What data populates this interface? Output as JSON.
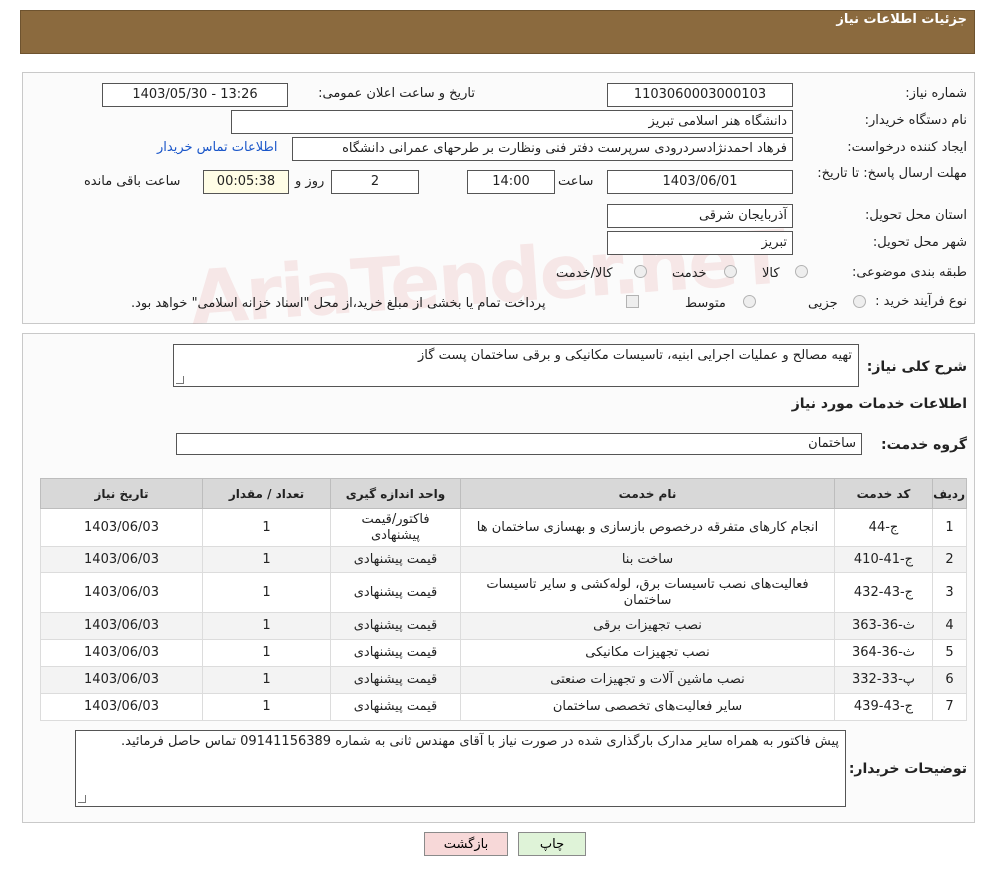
{
  "header": {
    "title": "جزئیات اطلاعات نیاز"
  },
  "watermark": "AriaTender.neT",
  "form": {
    "need_number_label": "شماره نیاز:",
    "need_number": "1103060003000103",
    "announce_label": "تاریخ و ساعت اعلان عمومی:",
    "announce_value": "1403/05/30 - 13:26",
    "buyer_org_label": "نام دستگاه خریدار:",
    "buyer_org": "دانشگاه هنر اسلامی تبریز",
    "requester_label": "ایجاد کننده درخواست:",
    "requester": "فرهاد احمدنژادسردرودی سرپرست دفتر فنی ونظارت بر طرحهای عمرانی دانشگاه",
    "contact_link": "اطلاعات تماس خریدار",
    "deadline_label": "مهلت ارسال پاسخ: تا تاریخ:",
    "deadline_date": "1403/06/01",
    "time_label": "ساعت",
    "deadline_time": "14:00",
    "days_value": "2",
    "days_label": "روز و",
    "remaining_value": "00:05:38",
    "remaining_label": "ساعت باقی مانده",
    "province_label": "استان محل تحویل:",
    "province": "آذربایجان شرقی",
    "city_label": "شهر محل تحویل:",
    "city": "تبریز",
    "category_label": "طبقه بندی موضوعی:",
    "category_options": [
      "کالا",
      "خدمت",
      "کالا/خدمت"
    ],
    "process_label": "نوع فرآیند خرید :",
    "process_options": [
      "جزیی",
      "متوسط"
    ],
    "payment_note": "پرداخت تمام یا بخشی از مبلغ خرید،از محل \"اسناد خزانه اسلامی\" خواهد بود."
  },
  "details": {
    "summary_label": "شرح کلی نیاز:",
    "summary": "تهیه مصالح و عملیات اجرایی ابنیه، تاسیسات مکانیکی و برقی ساختمان پست گاز",
    "services_title": "اطلاعات خدمات مورد نیاز",
    "service_group_label": "گروه خدمت:",
    "service_group": "ساختمان",
    "buyer_notes_label": "توضیحات خریدار:",
    "buyer_notes": "پیش فاکتور به همراه سایر مدارک بارگذاری شده در صورت نیاز با آقای مهندس ثانی به شماره 09141156389 تماس حاصل فرمائید."
  },
  "table": {
    "headers": [
      "ردیف",
      "کد خدمت",
      "نام خدمت",
      "واحد اندازه گیری",
      "تعداد / مقدار",
      "تاریخ نیاز"
    ],
    "rows": [
      {
        "row": "1",
        "code": "ج-44",
        "name": "انجام کارهای متفرقه درخصوص بازسازی و بهسازی ساختمان ها",
        "unit": "فاکتور/قیمت پیشنهادی",
        "qty": "1",
        "date": "1403/06/03"
      },
      {
        "row": "2",
        "code": "ج-41-410",
        "name": "ساخت بنا",
        "unit": "قیمت پیشنهادی",
        "qty": "1",
        "date": "1403/06/03"
      },
      {
        "row": "3",
        "code": "ج-43-432",
        "name": "فعالیت‌های نصب تاسیسات برق، لوله‌کشی و سایر تاسیسات ساختمان",
        "unit": "قیمت پیشنهادی",
        "qty": "1",
        "date": "1403/06/03"
      },
      {
        "row": "4",
        "code": "ث-36-363",
        "name": "نصب تجهیزات برقی",
        "unit": "قیمت پیشنهادی",
        "qty": "1",
        "date": "1403/06/03"
      },
      {
        "row": "5",
        "code": "ث-36-364",
        "name": "نصب تجهیزات مکانیکی",
        "unit": "قیمت پیشنهادی",
        "qty": "1",
        "date": "1403/06/03"
      },
      {
        "row": "6",
        "code": "پ-33-332",
        "name": "نصب ماشین آلات و تجهیزات صنعتی",
        "unit": "قیمت پیشنهادی",
        "qty": "1",
        "date": "1403/06/03"
      },
      {
        "row": "7",
        "code": "ج-43-439",
        "name": "سایر فعالیت‌های تخصصی ساختمان",
        "unit": "قیمت پیشنهادی",
        "qty": "1",
        "date": "1403/06/03"
      }
    ]
  },
  "buttons": {
    "print": "چاپ",
    "back": "بازگشت"
  }
}
